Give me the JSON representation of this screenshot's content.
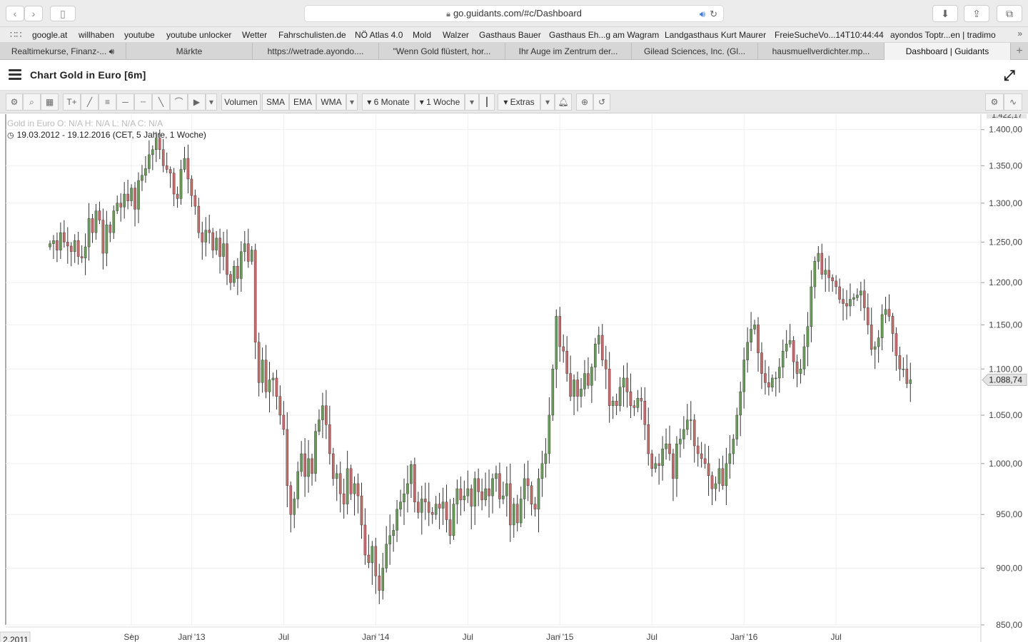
{
  "browser": {
    "url": "go.guidants.com/#c/Dashboard",
    "bookmarks": [
      "google.at",
      "willhaben",
      "youtube",
      "youtube unlocker",
      "Wetter",
      "Fahrschulisten.de",
      "NÖ Atlas 4.0",
      "Mold",
      "Walzer",
      "Gasthaus Bauer",
      "Gasthaus Eh...g am Wagram",
      "Landgasthaus Kurt Maurer",
      "FreieSucheVo...14T10:44:44",
      "ayondos Toptr...en | tradimo"
    ],
    "tabs": [
      "Realtimekurse, Finanz-...",
      "Märkte",
      "https://wetrade.ayondo....",
      "\"Wenn Gold flüstert, hor...",
      "Ihr Auge im Zentrum der...",
      "Gilead Sciences, Inc. (Gl...",
      "hausmuellverdichter.mp...",
      "Dashboard | Guidants"
    ],
    "active_tab": 7
  },
  "app": {
    "title": "Chart Gold in Euro [6m]"
  },
  "chart_toolbar": {
    "volumen": "Volumen",
    "sma": "SMA",
    "ema": "EMA",
    "wma": "WMA",
    "period": "6 Monate",
    "interval": "1 Woche",
    "extras": "Extras"
  },
  "chart_header": {
    "ohlc": "Gold in Euro  O: N/A  H: N/A  L: N/A  C: N/A",
    "range": "19.03.2012 - 19.12.2016  (CET, 5 Jahre, 1 Woche)",
    "current_price": "1.088,74",
    "top_cut_label": "1.422,17",
    "left_date_label": "2.2011"
  },
  "colors": {
    "up": "#6a9a5a",
    "down": "#c46a6a",
    "grid": "#efefef"
  },
  "chart_data": {
    "type": "candlestick",
    "title": "Chart Gold in Euro [6m]",
    "ylim": [
      850,
      1422
    ],
    "y_ticks": [
      850,
      900,
      950,
      1000,
      1050,
      1100,
      1150,
      1200,
      1250,
      1300,
      1350,
      1400
    ],
    "y_tick_labels": [
      "850,00",
      "900,00",
      "950,00",
      "1.000,00",
      "1.050,00",
      "1.100,00",
      "1.150,00",
      "1.200,00",
      "1.250,00",
      "1.300,00",
      "1.350,00",
      "1.400,00"
    ],
    "x_labels": [
      "Sep",
      "Jan '13",
      "Jul",
      "Jan '14",
      "Jul",
      "Jan '15",
      "Jul",
      "Jan '16",
      "Jul"
    ],
    "x_label_weeks": [
      23,
      40,
      66,
      92,
      118,
      144,
      170,
      196,
      222
    ],
    "closes": [
      1248,
      1252,
      1240,
      1262,
      1250,
      1245,
      1238,
      1252,
      1232,
      1230,
      1244,
      1280,
      1262,
      1290,
      1278,
      1236,
      1272,
      1262,
      1290,
      1300,
      1295,
      1312,
      1303,
      1320,
      1292,
      1330,
      1337,
      1346,
      1365,
      1372,
      1388,
      1372,
      1350,
      1345,
      1340,
      1312,
      1306,
      1345,
      1360,
      1332,
      1310,
      1296,
      1262,
      1250,
      1265,
      1262,
      1240,
      1255,
      1232,
      1248,
      1210,
      1200,
      1220,
      1205,
      1238,
      1248,
      1226,
      1240,
      1130,
      1085,
      1110,
      1075,
      1088,
      1090,
      1070,
      1050,
      1035,
      978,
      950,
      965,
      992,
      1010,
      987,
      1005,
      990,
      1033,
      1045,
      1060,
      1040,
      1010,
      985,
      990,
      970,
      960,
      995,
      970,
      980,
      968,
      940,
      912,
      905,
      920,
      893,
      880,
      900,
      922,
      930,
      935,
      955,
      962,
      970,
      980,
      999,
      962,
      952,
      965,
      962,
      952,
      950,
      960,
      956,
      962,
      945,
      930,
      960,
      975,
      964,
      968,
      975,
      958,
      985,
      972,
      964,
      975,
      968,
      985,
      990,
      965,
      968,
      980,
      940,
      960,
      942,
      965,
      985,
      978,
      960,
      955,
      985,
      1000,
      1010,
      1050,
      1100,
      1160,
      1125,
      1120,
      1095,
      1070,
      1088,
      1070,
      1078,
      1095,
      1082,
      1102,
      1128,
      1138,
      1110,
      1100,
      1060,
      1065,
      1060,
      1080,
      1090,
      1075,
      1060,
      1058,
      1068,
      1065,
      1040,
      1010,
      995,
      1000,
      998,
      1015,
      1020,
      1010,
      985,
      1020,
      1025,
      1035,
      1045,
      1045,
      1018,
      1010,
      1005,
      1000,
      988,
      975,
      980,
      995,
      978,
      1000,
      1010,
      1025,
      1050,
      1075,
      1110,
      1130,
      1145,
      1150,
      1118,
      1095,
      1085,
      1080,
      1090,
      1090,
      1102,
      1120,
      1128,
      1132,
      1108,
      1095,
      1100,
      1125,
      1148,
      1195,
      1226,
      1236,
      1210,
      1215,
      1206,
      1202,
      1195,
      1180,
      1175,
      1172,
      1180,
      1182,
      1185,
      1190,
      1170,
      1150,
      1122,
      1125,
      1135,
      1162,
      1168,
      1160,
      1140,
      1115,
      1100,
      1100,
      1084,
      1088
    ]
  }
}
